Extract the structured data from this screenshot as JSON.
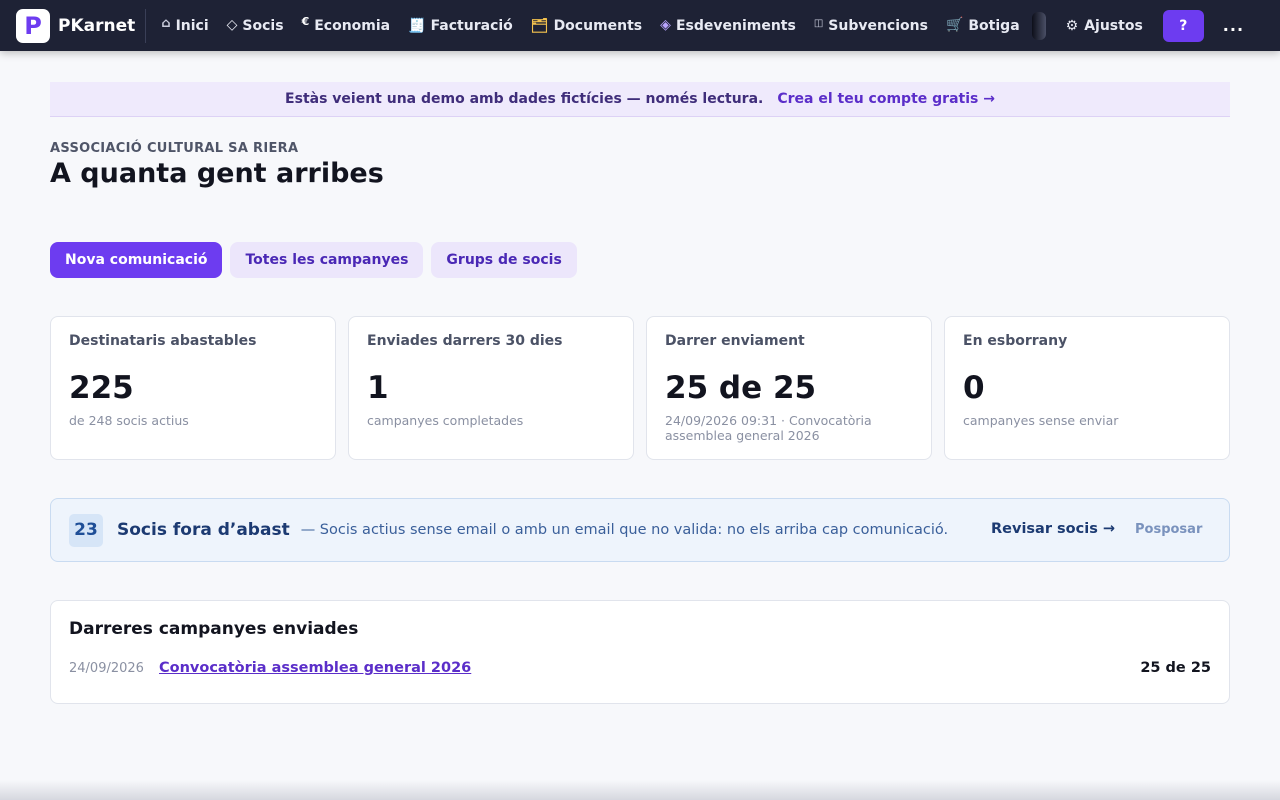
{
  "brand": {
    "logo_letter": "P",
    "name": "PKarnet"
  },
  "nav": {
    "items": [
      {
        "icon": "home-icon",
        "glyph": "⌂",
        "label": "Inici"
      },
      {
        "icon": "diamond-icon",
        "glyph": "◇",
        "label": "Socis"
      },
      {
        "icon": "euro-icon",
        "glyph": "€",
        "label": "Economia"
      },
      {
        "icon": "receipt-icon",
        "glyph": "🧾",
        "label": "Facturació"
      },
      {
        "icon": "folder-icon",
        "glyph": "🗂",
        "label": "Documents"
      },
      {
        "icon": "event-diamond-icon",
        "glyph": "◈",
        "label": "Esdeveniments"
      },
      {
        "icon": "book-icon",
        "glyph": "◫",
        "label": "Subvencions"
      },
      {
        "icon": "cart-icon",
        "glyph": "🛒",
        "label": "Botiga"
      }
    ],
    "settings": {
      "glyph": "⚙",
      "label": "Ajustos"
    },
    "help_label": "?",
    "more_label": "..."
  },
  "demo_banner": {
    "text": "Estàs veient una demo amb dades fictícies — només lectura.",
    "link": "Crea el teu compte gratis →"
  },
  "header": {
    "organization": "ASSOCIACIÓ CULTURAL SA RIERA",
    "title": "A quanta gent arribes"
  },
  "tabs": [
    {
      "label": "Nova comunicació",
      "active": true
    },
    {
      "label": "Totes les campanyes",
      "active": false
    },
    {
      "label": "Grups de socis",
      "active": false
    }
  ],
  "stats": [
    {
      "label": "Destinataris abastables",
      "value": "225",
      "sub": "de 248 socis actius"
    },
    {
      "label": "Enviades darrers 30 dies",
      "value": "1",
      "sub": "campanyes completades"
    },
    {
      "label": "Darrer enviament",
      "value": "25 de 25",
      "sub": "24/09/2026 09:31 · Convocatòria assemblea general 2026"
    },
    {
      "label": "En esborrany",
      "value": "0",
      "sub": "campanyes sense enviar"
    }
  ],
  "alert": {
    "count": "23",
    "title": "Socis fora d’abast",
    "description": "— Socis actius sense email o amb un email que no valida: no els arriba cap comunicació.",
    "action": "Revisar socis →",
    "dismiss": "Posposar"
  },
  "recent": {
    "title": "Darreres campanyes enviades",
    "rows": [
      {
        "date": "24/09/2026",
        "name": "Convocatòria assemblea general 2026",
        "count": "25 de 25"
      }
    ]
  },
  "colors": {
    "topbar": "#1e2235",
    "accent": "#6d3cf0",
    "alert_bg": "#eef4fc"
  }
}
